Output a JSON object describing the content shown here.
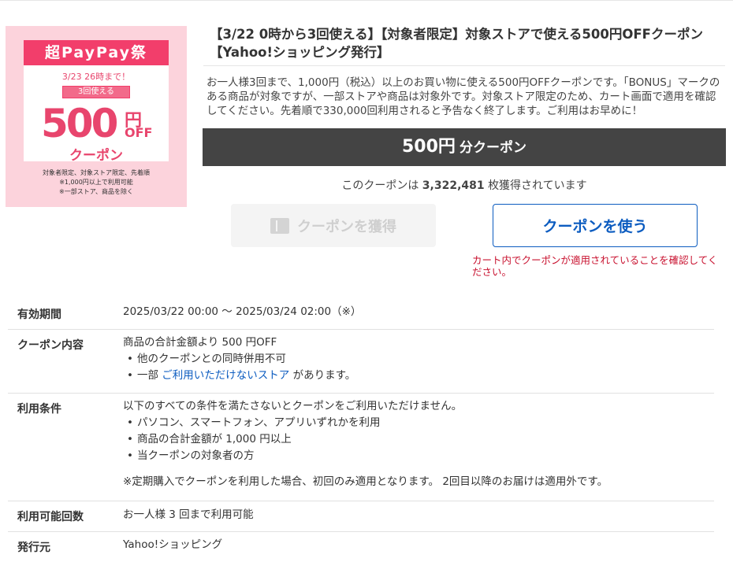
{
  "coupon_image": {
    "banner": "超PayPay祭",
    "deadline": "3/23 26時まで！",
    "uses": "3回使える",
    "amount": "500",
    "yen": "円",
    "off": "OFF",
    "word": "クーポン",
    "notes": [
      "対象者限定、対象ストア限定、先着順",
      "※1,000円以上で利用可能",
      "※一部ストア、商品を除く"
    ]
  },
  "title": "【3/22 0時から3回使える】【対象者限定】対象ストアで使える500円OFFクーポン【Yahoo!ショッピング発行】",
  "description": "お一人様3回まで、1,000円（税込）以上のお買い物に使える500円OFFクーポンです。「BONUS」マークのある商品が対象ですが、一部ストアや商品は対象外です。対象ストア限定のため、カート画面で適用を確認してください。先着順で330,000回利用されると予告なく終了します。ご利用はお早めに！",
  "amount_bar": {
    "value": "500円",
    "unit": "分クーポン"
  },
  "acquired": {
    "prefix": "このクーポンは",
    "count": "3,322,481",
    "suffix": "枚獲得されています"
  },
  "buttons": {
    "get": "クーポンを獲得",
    "use": "クーポンを使う"
  },
  "warning": "カート内でクーポンが適用されていることを確認してください。",
  "details": {
    "validity": {
      "label": "有効期間",
      "value": "2025/03/22 00:00 〜 2025/03/24 02:00（※）"
    },
    "content": {
      "label": "クーポン内容",
      "summary": "商品の合計金額より 500 円OFF",
      "items": [
        "他のクーポンとの同時併用不可"
      ],
      "partial_prefix": "一部",
      "partial_link": "ご利用いただけないストア",
      "partial_suffix": "があります。"
    },
    "conditions": {
      "label": "利用条件",
      "intro": "以下のすべての条件を満たさないとクーポンをご利用いただけません。",
      "items": [
        "パソコン、スマートフォン、アプリいずれかを利用",
        "商品の合計金額が 1,000 円以上",
        "当クーポンの対象者の方"
      ],
      "note": "※定期購入でクーポンを利用した場合、初回のみ適用となります。 2回目以降のお届けは適用外です。"
    },
    "usage_count": {
      "label": "利用可能回数",
      "value": "お一人様 3 回まで利用可能"
    },
    "issuer": {
      "label": "発行元",
      "value": "Yahoo!ショッピング"
    }
  },
  "colors": {
    "brand_pink": "#f23e6b",
    "link_blue": "#0c5cc0",
    "warning_red": "#c8102e",
    "bar_dark": "#444444"
  }
}
